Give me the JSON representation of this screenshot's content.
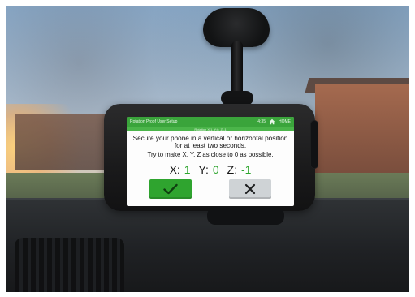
{
  "app": {
    "statusbar": {
      "title": "Rotation Proof User Setup",
      "time": "4:35",
      "home_label": "HOME"
    },
    "subbar_text": "Rotation X:1, Y:0, Z:-1",
    "instructions": {
      "line1": "Secure your phone in a vertical or horizontal position for at least two seconds.",
      "line2": "Try to make X, Y, Z as close to 0 as possible."
    },
    "coordinates": {
      "x_label": "X:",
      "x_value": "1",
      "y_label": "Y:",
      "y_value": "0",
      "z_label": "Z:",
      "z_value": "-1"
    },
    "actions": {
      "confirm_icon": "check-icon",
      "cancel_icon": "close-icon"
    },
    "colors": {
      "accent_green": "#2fa42f",
      "status_green": "#3aa43b",
      "cancel_gray": "#cfd3d6"
    }
  }
}
